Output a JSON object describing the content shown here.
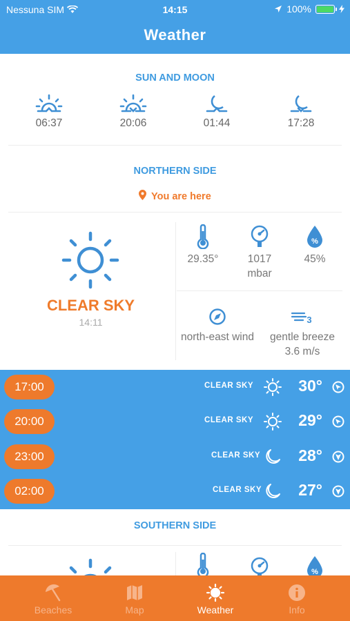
{
  "status_bar": {
    "carrier": "Nessuna SIM",
    "time": "14:15",
    "battery": "100%"
  },
  "header": {
    "title": "Weather"
  },
  "sun_moon": {
    "title": "SUN AND MOON",
    "items": [
      {
        "icon": "sunrise-icon",
        "value": "06:37"
      },
      {
        "icon": "sunset-icon",
        "value": "20:06"
      },
      {
        "icon": "moonrise-icon",
        "value": "01:44"
      },
      {
        "icon": "moonset-icon",
        "value": "17:28"
      }
    ]
  },
  "northern": {
    "title": "NORTHERN SIDE",
    "you_are_here": "You are here",
    "condition": "CLEAR SKY",
    "updated": "14:11",
    "temperature": "29.35°",
    "pressure_value": "1017",
    "pressure_unit": "mbar",
    "humidity": "45%",
    "wind_direction": "north-east wind",
    "wind_desc": "gentle breeze",
    "wind_speed": "3.6 m/s"
  },
  "forecast": [
    {
      "time": "17:00",
      "condition": "CLEAR SKY",
      "icon": "sun-icon",
      "temp": "30°"
    },
    {
      "time": "20:00",
      "condition": "CLEAR SKY",
      "icon": "sun-icon",
      "temp": "29°"
    },
    {
      "time": "23:00",
      "condition": "CLEAR SKY",
      "icon": "moon-icon",
      "temp": "28°"
    },
    {
      "time": "02:00",
      "condition": "CLEAR SKY",
      "icon": "moon-icon",
      "temp": "27°"
    }
  ],
  "southern": {
    "title": "SOUTHERN SIDE"
  },
  "tabs": [
    {
      "label": "Beaches",
      "icon": "beach-umbrella-icon",
      "active": false
    },
    {
      "label": "Map",
      "icon": "map-icon",
      "active": false
    },
    {
      "label": "Weather",
      "icon": "sun-icon",
      "active": true
    },
    {
      "label": "Info",
      "icon": "info-icon",
      "active": false
    }
  ],
  "colors": {
    "primary_blue": "#45a0e6",
    "accent_orange": "#ee7a2c"
  }
}
